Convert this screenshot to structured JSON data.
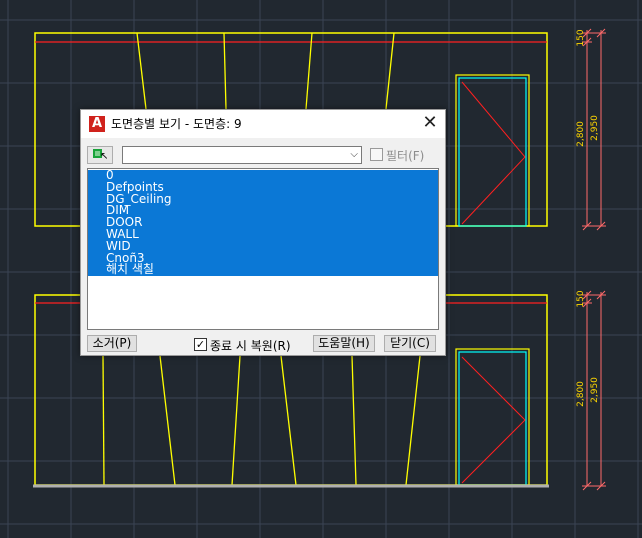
{
  "dialog": {
    "title": "도면층별 보기 - 도면층: 9",
    "app_icon": "A",
    "close_glyph": "✕",
    "filter_label": "필터(F)",
    "filter_value": "",
    "chevron": "⌵",
    "layers": [
      "0",
      "Defpoints",
      "DG_Ceiling",
      "DIM",
      "DOOR",
      "WALL",
      "WID",
      "Cnoñ3",
      "해치 색칠"
    ],
    "invert_label": "소거(P)",
    "restore_label": "종료 시 복원(R)",
    "restore_checked": true,
    "check_glyph": "✓",
    "help_label": "도움말(H)",
    "close_label": "닫기(C)"
  },
  "drawing": {
    "dims_top": [
      "150",
      "2,800",
      "2,950"
    ],
    "dims_bottom": [
      "150",
      "2,800",
      "2,950"
    ],
    "colors": {
      "background": "#212830",
      "grid": "#3a4454",
      "wall": "#ffff00",
      "cut_line": "#ff2020",
      "door": "#00ffff",
      "dimension": "#ff6a6a",
      "dim_text": "#ffd700",
      "floor": "#b0b0b0"
    }
  }
}
